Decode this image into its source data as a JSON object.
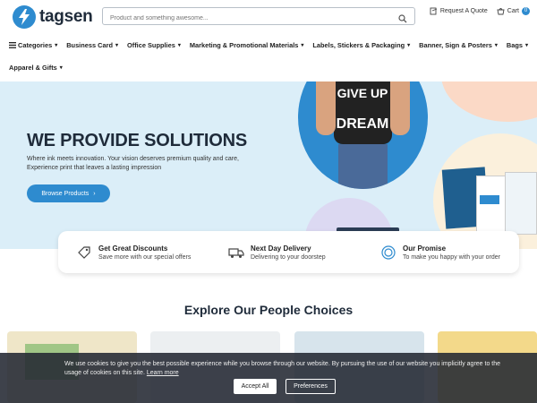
{
  "brand": {
    "name": "tagsen",
    "logo_icon": "lightning-bolt"
  },
  "search": {
    "placeholder": "Product and something awesome..."
  },
  "top_links": {
    "quote_label": "Request A Quote",
    "cart_label": "Cart",
    "cart_count": "0"
  },
  "nav": {
    "items": [
      {
        "label": "Categories",
        "icon": "menu-icon"
      },
      {
        "label": "Business Card"
      },
      {
        "label": "Office Supplies"
      },
      {
        "label": "Marketing & Promotional Materials"
      },
      {
        "label": "Labels, Stickers & Packaging"
      },
      {
        "label": "Banner, Sign & Posters"
      },
      {
        "label": "Bags"
      },
      {
        "label": "Apparel & Gifts"
      }
    ]
  },
  "hero": {
    "title": "WE PROVIDE SOLUTIONS",
    "subtitle": "Where ink meets innovation. Your vision deserves premium quality and care, Experience print that leaves a lasting impression",
    "button_label": "Browse Products",
    "shirt_text": "GIVE UP DREAM"
  },
  "features": [
    {
      "title": "Get Great Discounts",
      "subtitle": "Save more with our special offers",
      "icon": "tag-icon"
    },
    {
      "title": "Next Day Delivery",
      "subtitle": "Delivering to your doorstep",
      "icon": "truck-icon"
    },
    {
      "title": "Our Promise",
      "subtitle": "To make you happy with your order",
      "icon": "badge-icon"
    }
  ],
  "section": {
    "title": "Explore Our People Choices"
  },
  "cookie": {
    "text": "We use cookies to give you the best possible experience while you browse through our website. By pursuing the use of our website you implicitly agree to the usage of cookies on this site.",
    "learn_more": "Learn more",
    "accept_label": "Accept All",
    "prefs_label": "Preferences"
  },
  "colors": {
    "accent": "#2e8bcf",
    "hero_bg": "#dbeef8",
    "peach": "#fbd9c6",
    "cream": "#fbf0dc",
    "lavender": "#dcd9f2"
  }
}
